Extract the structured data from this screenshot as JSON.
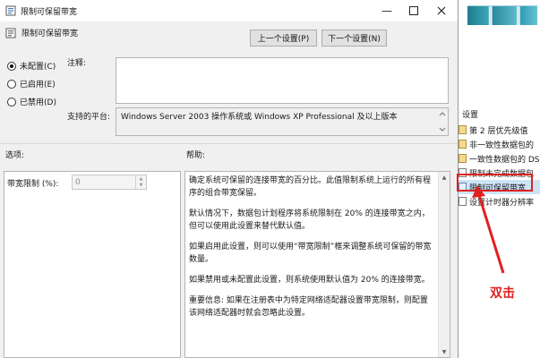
{
  "dialog": {
    "title": "限制可保留带宽",
    "policy_name": "限制可保留带宽",
    "prev_button": "上一个设置(P)",
    "next_button": "下一个设置(N)",
    "radios": [
      {
        "label": "未配置(C)",
        "selected": true
      },
      {
        "label": "已启用(E)",
        "selected": false
      },
      {
        "label": "已禁用(D)",
        "selected": false
      }
    ],
    "comment_label": "注释:",
    "comment_value": "",
    "platform_label": "支持的平台:",
    "platform_value": "Windows Server 2003 操作系统或 Windows XP Professional 及以上版本",
    "options_label": "选项:",
    "help_label": "帮助:",
    "bandwidth_label": "带宽限制 (%):",
    "bandwidth_value": "0",
    "help_paragraphs": [
      "确定系统可保留的连接带宽的百分比。此值限制系统上运行的所有程序的组合带宽保留。",
      "默认情况下，数据包计划程序将系统限制在 20% 的连接带宽之内，但可以使用此设置来替代默认值。",
      "如果启用此设置，则可以使用“带宽限制”框来调整系统可保留的带宽数量。",
      "如果禁用或未配置此设置，则系统使用默认值为 20% 的连接带宽。",
      "重要信息: 如果在注册表中为特定网络适配器设置带宽限制，则配置该网络适配器时就会忽略此设置。"
    ]
  },
  "background": {
    "section_header": "设置",
    "items": [
      {
        "label": "第 2 层优先级值",
        "type": "folder",
        "selected": false
      },
      {
        "label": "非一致性数据包的",
        "type": "folder",
        "selected": false
      },
      {
        "label": "一致性数据包的 DS",
        "type": "folder",
        "selected": false
      },
      {
        "label": "限制未完成数据包",
        "type": "doc",
        "selected": false
      },
      {
        "label": "限制可保留带宽",
        "type": "doc",
        "selected": true
      },
      {
        "label": "设置计时器分辨率",
        "type": "doc",
        "selected": false
      }
    ]
  },
  "annotation": {
    "label": "双击",
    "color": "#e02020"
  }
}
